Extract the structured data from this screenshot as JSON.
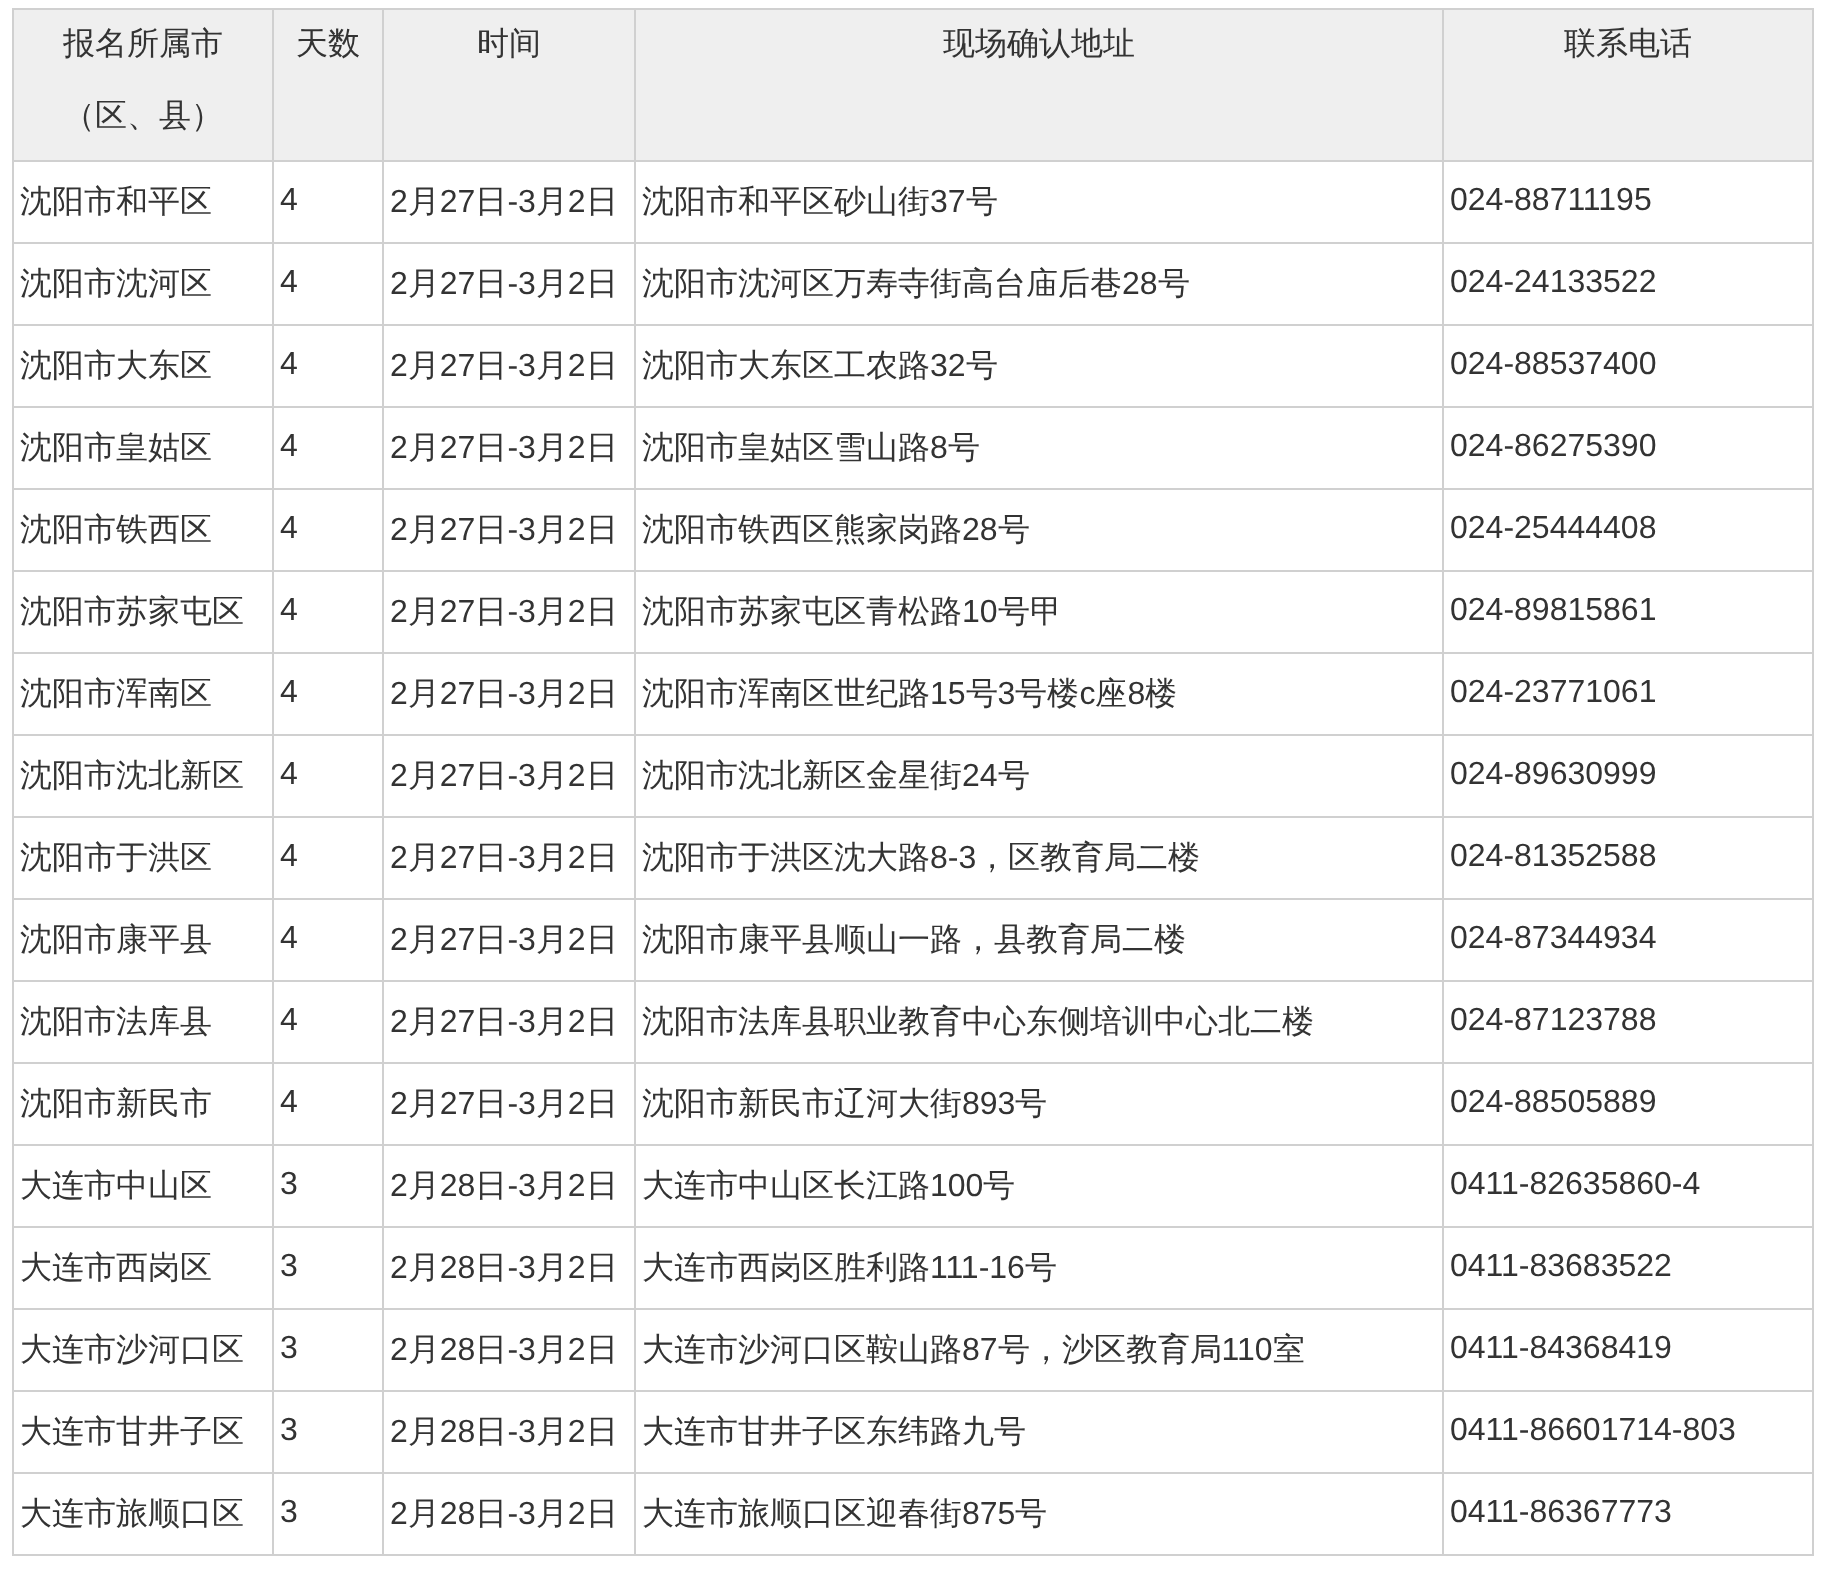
{
  "table": {
    "columns": [
      "报名所属市（区、县）",
      "天数",
      "时间",
      "现场确认地址",
      "联系电话"
    ],
    "rows": [
      [
        "沈阳市和平区",
        "4",
        "2月27日-3月2日",
        "沈阳市和平区砂山街37号",
        "024-88711195"
      ],
      [
        "沈阳市沈河区",
        "4",
        "2月27日-3月2日",
        "沈阳市沈河区万寿寺街高台庙后巷28号",
        "024-24133522"
      ],
      [
        "沈阳市大东区",
        "4",
        "2月27日-3月2日",
        "沈阳市大东区工农路32号",
        "024-88537400"
      ],
      [
        "沈阳市皇姑区",
        "4",
        "2月27日-3月2日",
        "沈阳市皇姑区雪山路8号",
        "024-86275390"
      ],
      [
        "沈阳市铁西区",
        "4",
        "2月27日-3月2日",
        "沈阳市铁西区熊家岗路28号",
        "024-25444408"
      ],
      [
        "沈阳市苏家屯区",
        "4",
        "2月27日-3月2日",
        "沈阳市苏家屯区青松路10号甲",
        "024-89815861"
      ],
      [
        "沈阳市浑南区",
        "4",
        "2月27日-3月2日",
        "沈阳市浑南区世纪路15号3号楼c座8楼",
        "024-23771061"
      ],
      [
        "沈阳市沈北新区",
        "4",
        "2月27日-3月2日",
        "沈阳市沈北新区金星街24号",
        "024-89630999"
      ],
      [
        "沈阳市于洪区",
        "4",
        "2月27日-3月2日",
        "沈阳市于洪区沈大路8-3，区教育局二楼",
        "024-81352588"
      ],
      [
        "沈阳市康平县",
        "4",
        "2月27日-3月2日",
        "沈阳市康平县顺山一路，县教育局二楼",
        "024-87344934"
      ],
      [
        "沈阳市法库县",
        "4",
        "2月27日-3月2日",
        "沈阳市法库县职业教育中心东侧培训中心北二楼",
        "024-87123788"
      ],
      [
        "沈阳市新民市",
        "4",
        "2月27日-3月2日",
        "沈阳市新民市辽河大街893号",
        "024-88505889"
      ],
      [
        "大连市中山区",
        "3",
        "2月28日-3月2日",
        "大连市中山区长江路100号",
        "0411-82635860-4"
      ],
      [
        "大连市西岗区",
        "3",
        "2月28日-3月2日",
        "大连市西岗区胜利路111-16号",
        "0411-83683522"
      ],
      [
        "大连市沙河口区",
        "3",
        "2月28日-3月2日",
        "大连市沙河口区鞍山路87号，沙区教育局110室",
        "0411-84368419"
      ],
      [
        "大连市甘井子区",
        "3",
        "2月28日-3月2日",
        "大连市甘井子区东纬路九号",
        "0411-86601714-803"
      ],
      [
        "大连市旅顺口区",
        "3",
        "2月28日-3月2日",
        "大连市旅顺口区迎春街875号",
        "0411-86367773"
      ]
    ]
  }
}
